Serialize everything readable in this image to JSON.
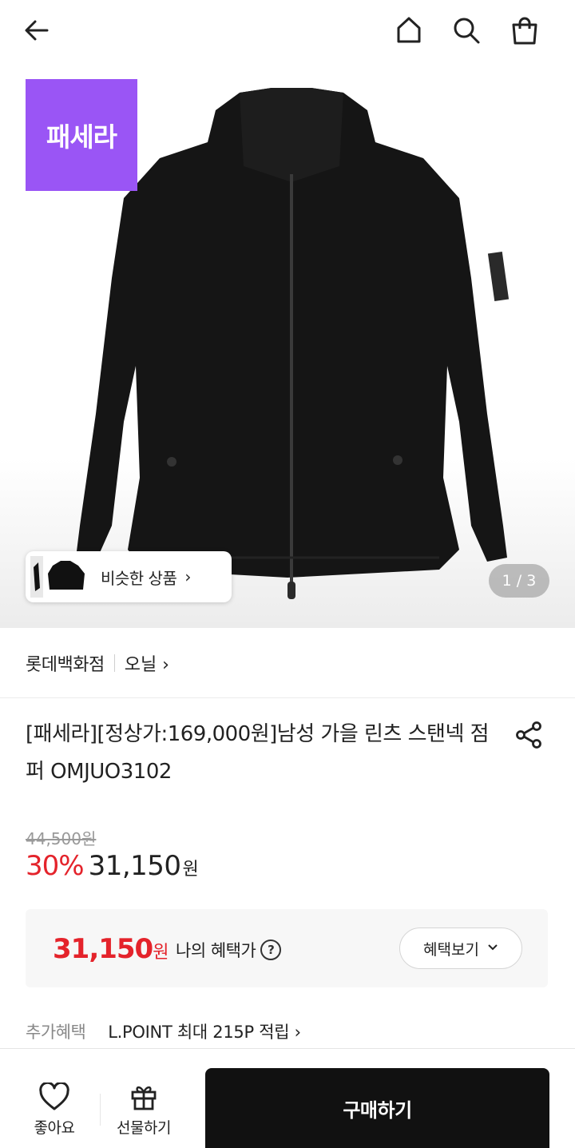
{
  "header": {
    "back_icon": "arrow-left-icon",
    "home_icon": "home-icon",
    "search_icon": "search-icon",
    "cart_icon": "shopping-bag-icon"
  },
  "hero": {
    "brand_badge": "패세라",
    "brand_badge_color": "#9a55f5",
    "similar_label": "비슷한 상품",
    "similar_arrow": "›",
    "page_indicator": "1 / 3"
  },
  "store": {
    "name": "롯데백화점",
    "brand": "오닐 ›"
  },
  "product": {
    "title": "[패세라][정상가:169,000원]남성 가을 린츠 스탠넥 점퍼 OMJUO3102",
    "original_price": "44,500원",
    "discount": "30%",
    "sale_price": "31,150",
    "won": "원"
  },
  "benefit": {
    "price": "31,150",
    "won": "원",
    "label": "나의 혜택가",
    "help": "?",
    "button_label": "혜택보기",
    "button_chevron": "⌄"
  },
  "extra": {
    "label": "추가혜택",
    "value": "L.POINT 최대 215P 적립 ›"
  },
  "bottom": {
    "like_label": "좋아요",
    "gift_label": "선물하기",
    "buy_label": "구매하기"
  },
  "colors": {
    "accent_red": "#e4232b",
    "buy_button": "#111111"
  }
}
